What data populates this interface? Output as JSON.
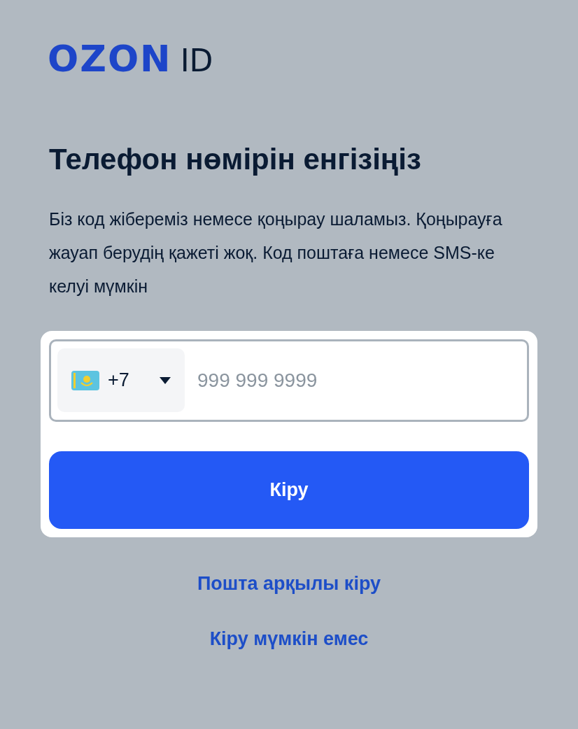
{
  "logo": {
    "brand": "OZON",
    "suffix": "ID"
  },
  "heading": "Телефон нөмірін енгізіңіз",
  "description": "Біз код жібереміз немесе қоңырау шаламыз. Қоңырауға жауап берудің қажеті жоқ. Код поштаға немесе SMS-ке келуі мүмкін",
  "phone_field": {
    "country_code": "+7",
    "placeholder": "999 999 9999"
  },
  "submit_button": "Кіру",
  "links": [
    "Пошта арқылы кіру",
    "Кіру мүмкін емес"
  ]
}
